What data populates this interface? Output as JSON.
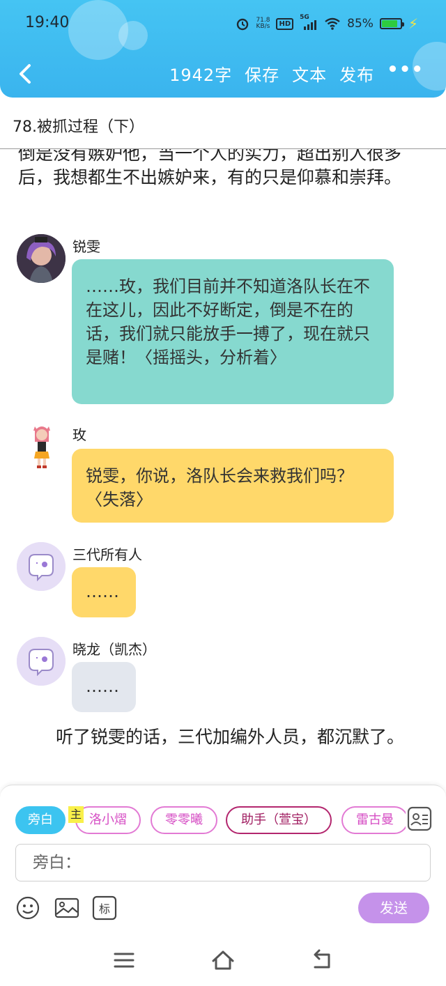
{
  "status": {
    "time": "19:40",
    "net_speed": "71.8",
    "net_unit": "KB/s",
    "hd": "HD",
    "signal": "5G",
    "battery": "85%",
    "battery_level": 0.85
  },
  "toolbar": {
    "word_count": "1942字",
    "save": "保存",
    "text": "文本",
    "publish": "发布",
    "more": "•••"
  },
  "chapter_title": "78.被抓过程（下）",
  "story": {
    "para_top": "倒是没有嫉妒他，当一个人的实力，超出别人很多后，我想都生不出嫉妒来，有的只是仰慕和崇拜。",
    "messages": [
      {
        "name": "锐雯",
        "text": "……玫，我们目前并不知道洛队长在不在这儿，因此不好断定，倒是不在的话，我们就只能放手一搏了，现在就只是赌！〈摇摇头，分析着〉"
      },
      {
        "name": "玫",
        "text": "锐雯，你说，洛队长会来救我们吗？〈失落〉"
      },
      {
        "name": "三代所有人",
        "text": "……"
      },
      {
        "name": "晓龙（凯杰）",
        "text": "……"
      }
    ],
    "para_bottom": "听了锐雯的话，三代加编外人员，都沉默了。"
  },
  "input_panel": {
    "roles": [
      "旁白",
      "洛小熠",
      "零零曦",
      "助手（萱宝）",
      "雷古曼"
    ],
    "master_tag": "主",
    "placeholder": "旁白：",
    "send": "发送"
  },
  "colors": {
    "header": "#3ab4ee",
    "teal_bubble": "#86d9cf",
    "yellow_bubble": "#ffd86a",
    "grey_bubble": "#e3e7ee",
    "send_button": "#c592ea",
    "active_role": "#3cc4f0"
  }
}
